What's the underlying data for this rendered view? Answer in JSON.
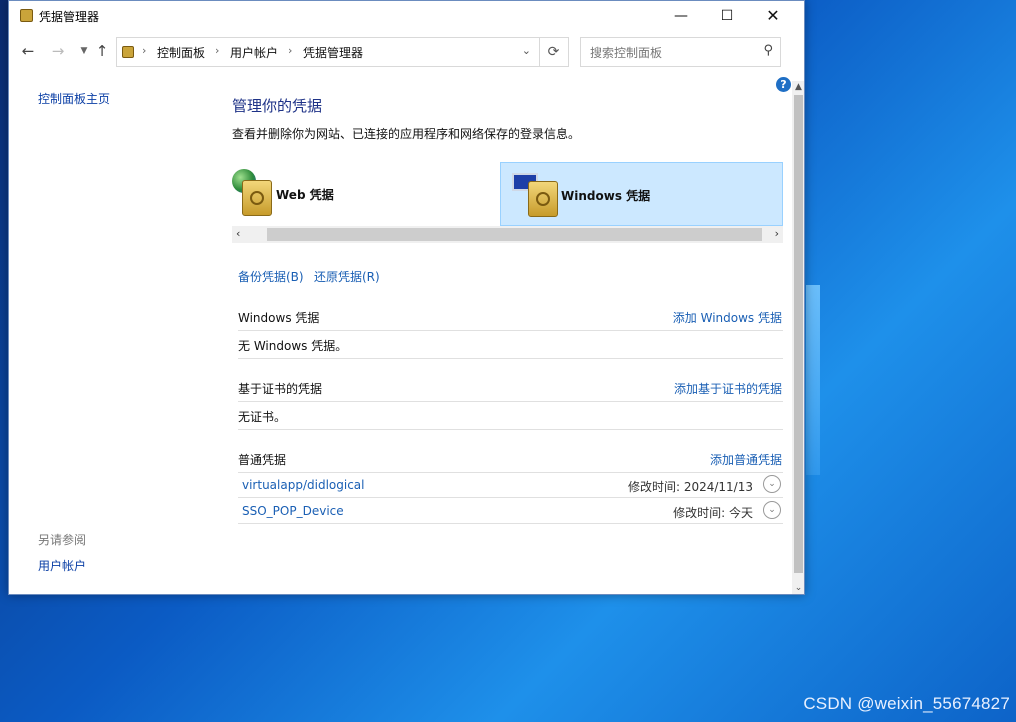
{
  "window": {
    "title": "凭据管理器",
    "buttons": {
      "minimize": "—",
      "maximize": "☐",
      "close": "✕"
    }
  },
  "navigation": {
    "breadcrumbs": [
      "控制面板",
      "用户帐户",
      "凭据管理器"
    ],
    "search_placeholder": "搜索控制面板"
  },
  "sidebar": {
    "home_link": "控制面板主页",
    "see_also_heading": "另请参阅",
    "see_also_link": "用户帐户"
  },
  "main": {
    "heading": "管理你的凭据",
    "description": "查看并删除你为网站、已连接的应用程序和网络保存的登录信息。",
    "tabs": [
      {
        "label": "Web 凭据",
        "selected": false
      },
      {
        "label": "Windows 凭据",
        "selected": true
      }
    ],
    "actions": {
      "backup": "备份凭据(B)",
      "restore": "还原凭据(R)"
    },
    "sections": {
      "windows": {
        "title": "Windows 凭据",
        "add": "添加 Windows 凭据",
        "empty": "无 Windows 凭据。"
      },
      "certificate": {
        "title": "基于证书的凭据",
        "add": "添加基于证书的凭据",
        "empty": "无证书。"
      },
      "generic": {
        "title": "普通凭据",
        "add": "添加普通凭据",
        "items": [
          {
            "name": "virtualapp/didlogical",
            "modified_label": "修改时间:",
            "modified": "2024/11/13"
          },
          {
            "name": "SSO_POP_Device",
            "modified_label": "修改时间:",
            "modified": "今天"
          }
        ]
      }
    }
  },
  "desktop": {
    "watermark": "CSDN @weixin_55674827"
  },
  "colors": {
    "link": "#1a5fb4",
    "heading": "#1e3287",
    "selected_tab": "#cce8ff"
  }
}
